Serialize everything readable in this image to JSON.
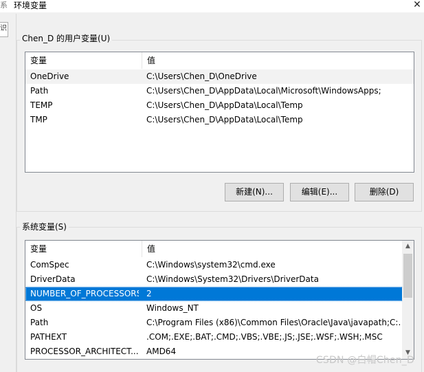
{
  "window": {
    "title": "环境变量",
    "close_glyph": "✕",
    "bg_char_top": "系",
    "bg_char_side": "识"
  },
  "user_vars": {
    "group_label": "Chen_D 的用户变量(U)",
    "headers": {
      "name": "变量",
      "value": "值"
    },
    "rows": [
      {
        "name": "OneDrive",
        "value": "C:\\Users\\Chen_D\\OneDrive"
      },
      {
        "name": "Path",
        "value": "C:\\Users\\Chen_D\\AppData\\Local\\Microsoft\\WindowsApps;"
      },
      {
        "name": "TEMP",
        "value": "C:\\Users\\Chen_D\\AppData\\Local\\Temp"
      },
      {
        "name": "TMP",
        "value": "C:\\Users\\Chen_D\\AppData\\Local\\Temp"
      }
    ],
    "buttons": {
      "new": "新建(N)...",
      "edit": "编辑(E)...",
      "delete": "删除(D)"
    }
  },
  "system_vars": {
    "group_label": "系统变量(S)",
    "headers": {
      "name": "变量",
      "value": "值"
    },
    "rows": [
      {
        "name": "ComSpec",
        "value": "C:\\Windows\\system32\\cmd.exe"
      },
      {
        "name": "DriverData",
        "value": "C:\\Windows\\System32\\Drivers\\DriverData"
      },
      {
        "name": "NUMBER_OF_PROCESSORS",
        "value": "2"
      },
      {
        "name": "OS",
        "value": "Windows_NT"
      },
      {
        "name": "Path",
        "value": "C:\\Program Files (x86)\\Common Files\\Oracle\\Java\\javapath;C:..."
      },
      {
        "name": "PATHEXT",
        "value": ".COM;.EXE;.BAT;.CMD;.VBS;.VBE;.JS;.JSE;.WSF;.WSH;.MSC"
      },
      {
        "name": "PROCESSOR_ARCHITECT...",
        "value": "AMD64"
      }
    ],
    "selected_row": "NUMBER_OF_PROCESSORS",
    "scroll_up_glyph": "▲",
    "scroll_down_glyph": "▼"
  },
  "watermark": "CSDN @白帽Chen_D",
  "colors": {
    "selection": "#0078d7",
    "button_face": "#e1e1e1",
    "window_bg": "#f0f0f0"
  }
}
